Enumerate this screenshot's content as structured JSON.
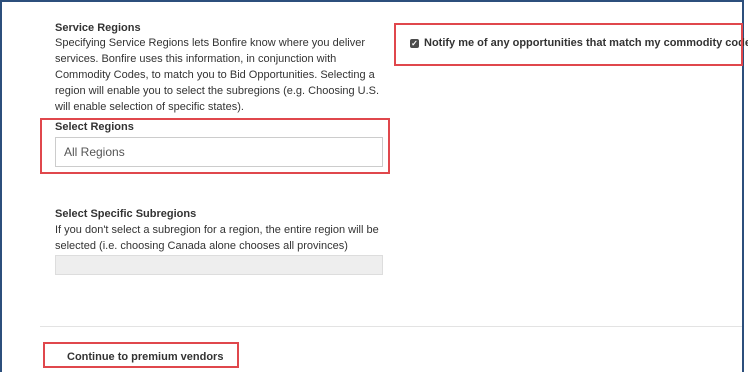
{
  "service_regions": {
    "title": "Service Regions",
    "help_lines": [
      "Specifying Service Regions lets Bonfire know where you deliver",
      "services. Bonfire uses this information, in conjunction with",
      "Commodity Codes, to match you to Bid Opportunities. Selecting a",
      "region will enable you to select the subregions (e.g. Choosing U.S.",
      "will enable selection of specific states)."
    ]
  },
  "select_regions": {
    "label": "Select Regions",
    "value": "All Regions"
  },
  "select_subregions": {
    "label": "Select Specific Subregions",
    "help_lines": [
      "If you don't select a subregion for a region, the entire region will be",
      "selected (i.e. choosing Canada alone chooses all provinces)"
    ],
    "value": ""
  },
  "notify": {
    "checked": true,
    "label": "Notify me of any opportunities that match my commodity codes"
  },
  "continue_button": {
    "label": "Continue to premium vendors"
  },
  "colors": {
    "frame": "#2c4f7c",
    "highlight": "#e0474c"
  }
}
